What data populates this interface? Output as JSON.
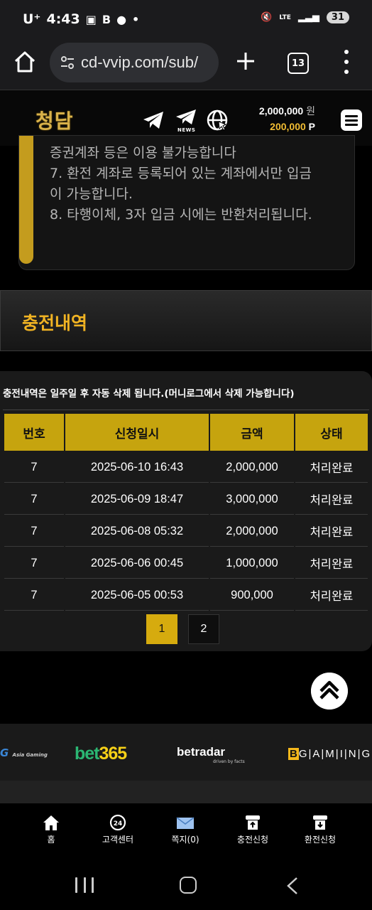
{
  "status_bar": {
    "carrier": "U⁺",
    "time": "4:43",
    "network": "LTE",
    "battery": "31"
  },
  "browser": {
    "url": "cd-vvip.com/sub/",
    "tab_count": "13"
  },
  "site_header": {
    "logo": "청담",
    "news_label": "NEWS",
    "money_amount": "2,000,000",
    "money_unit": "원",
    "point_amount": "200,000",
    "point_unit": "P"
  },
  "notice": {
    "lines": [
      "증권계좌 등은 이용 불가능합니다",
      "7. 환전 계좌로 등록되어 있는 계좌에서만 입금",
      "이 가능합니다.",
      "8. 타행이체, 3자 입금 시에는 반환처리됩니다."
    ]
  },
  "section": {
    "title": "충전내역"
  },
  "history": {
    "note": "충전내역은 일주일 후 자동 삭제 됩니다.(머니로그에서 삭제 가능합니다)",
    "columns": [
      "번호",
      "신청일시",
      "금액",
      "상태"
    ],
    "rows": [
      [
        "7",
        "2025-06-10 16:43",
        "2,000,000",
        "처리완료"
      ],
      [
        "7",
        "2025-06-09 18:47",
        "3,000,000",
        "처리완료"
      ],
      [
        "7",
        "2025-06-08 05:32",
        "2,000,000",
        "처리완료"
      ],
      [
        "7",
        "2025-06-06 00:45",
        "1,000,000",
        "처리완료"
      ],
      [
        "7",
        "2025-06-05 00:53",
        "900,000",
        "처리완료"
      ]
    ],
    "pages": [
      "1",
      "2"
    ],
    "current_page": "1"
  },
  "partners": {
    "asia_gaming": "G",
    "asia_gaming_small": "Asia Gaming",
    "bet365_a": "bet",
    "bet365_b": "365",
    "betradar": "betradar",
    "betradar_sub": "driven by facts",
    "bgaming_b": "B",
    "bgaming_rest": "G|A|M|I|N|G"
  },
  "bottom_nav": [
    {
      "label": "홈",
      "icon": "home-icon"
    },
    {
      "label": "고객센터",
      "icon": "support-24-icon"
    },
    {
      "label": "쪽지(0)",
      "icon": "mail-icon"
    },
    {
      "label": "충전신청",
      "icon": "deposit-icon"
    },
    {
      "label": "환전신청",
      "icon": "withdraw-icon"
    }
  ],
  "colors": {
    "accent_gold": "#c6a40e",
    "title_gold": "#f0b323",
    "point_gold": "#f2bd33",
    "background": "#000000"
  }
}
